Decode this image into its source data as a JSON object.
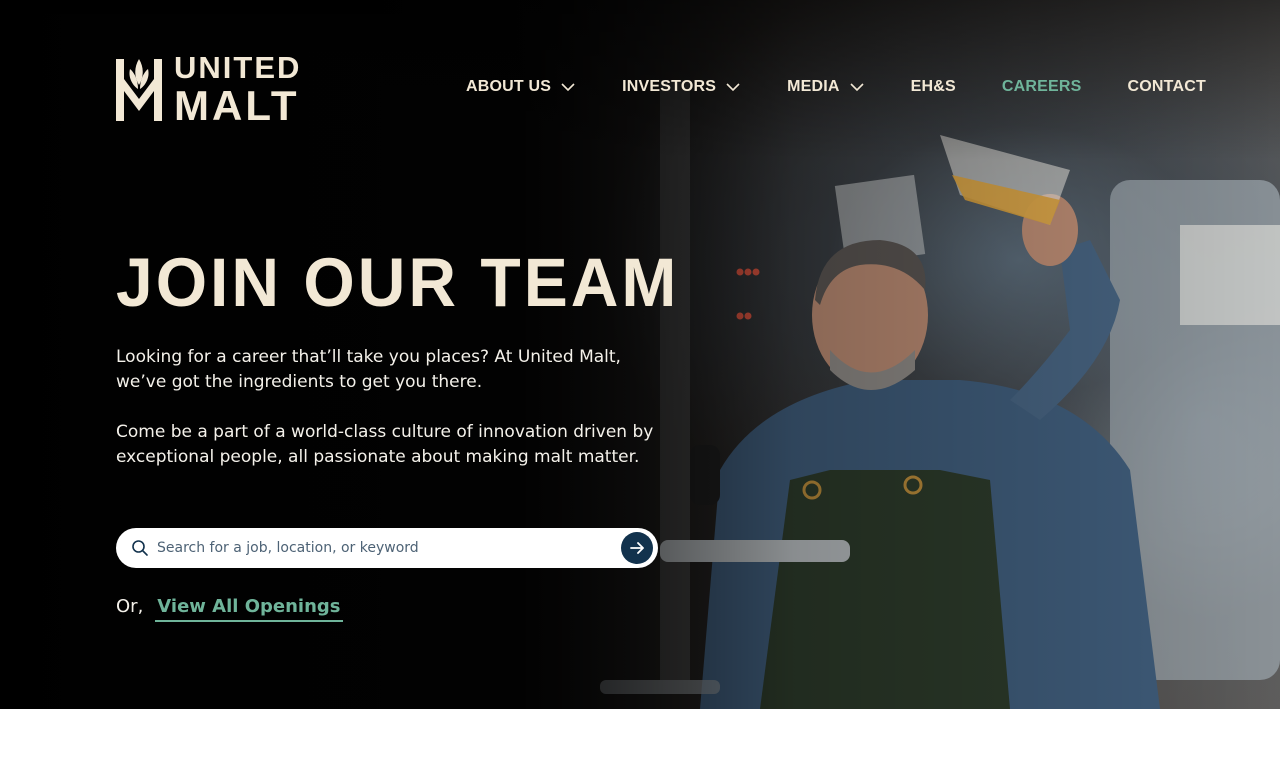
{
  "brand": {
    "line1": "UNITED",
    "line2": "MALT",
    "logo_icon": "wheat-leaf-m-icon"
  },
  "nav": {
    "items": [
      {
        "label": "ABOUT US",
        "has_dropdown": true
      },
      {
        "label": "INVESTORS",
        "has_dropdown": true
      },
      {
        "label": "MEDIA",
        "has_dropdown": true
      },
      {
        "label": "EH&S",
        "has_dropdown": false
      },
      {
        "label": "CAREERS",
        "has_dropdown": false,
        "active": true
      },
      {
        "label": "CONTACT",
        "has_dropdown": false
      }
    ]
  },
  "hero": {
    "title": "JOIN OUR TEAM",
    "paragraph1": "Looking for a career that’ll take you places? At United Malt, we’ve got the ingredients to get you there.",
    "paragraph2": "Come be a part of a world-class culture of innovation driven by exceptional people, all passionate about making malt matter.",
    "search": {
      "placeholder": "Search for a job, location, or keyword",
      "value": "",
      "icon": "search-icon",
      "submit_icon": "arrow-right-icon"
    },
    "or_label": "Or,",
    "view_all_label": "View All Openings"
  },
  "colors": {
    "cream": "#f2e8d5",
    "accent_green": "#6fb49a",
    "navy": "#12324d"
  }
}
